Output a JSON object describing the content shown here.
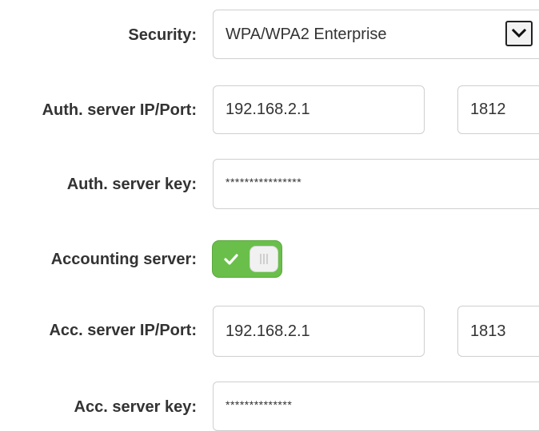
{
  "security": {
    "label": "Security:",
    "selected": "WPA/WPA2 Enterprise"
  },
  "auth_server": {
    "label": "Auth. server IP/Port:",
    "ip": "192.168.2.1",
    "port": "1812"
  },
  "auth_key": {
    "label": "Auth. server key:",
    "value": "****************"
  },
  "accounting": {
    "label": "Accounting server:",
    "enabled": true,
    "on_color": "#6abf4b"
  },
  "acc_server": {
    "label": "Acc. server IP/Port:",
    "ip": "192.168.2.1",
    "port": "1813"
  },
  "acc_key": {
    "label": "Acc. server key:",
    "value": "**************"
  },
  "icons": {
    "dropdown": "chevron-down-icon",
    "toggle_on": "check-icon"
  }
}
